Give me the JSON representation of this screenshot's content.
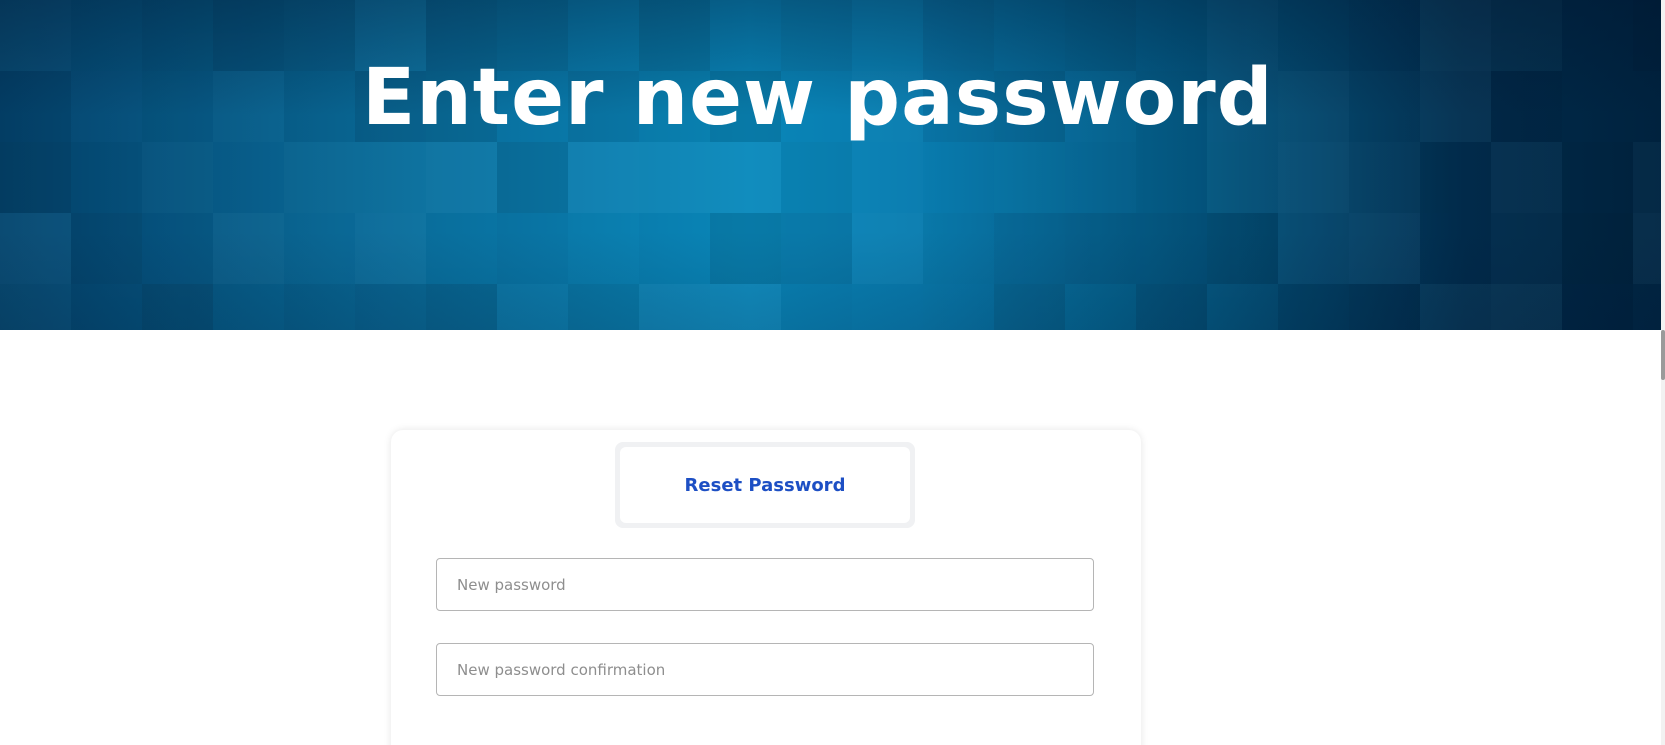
{
  "hero": {
    "title": "Enter new password"
  },
  "form": {
    "tab_label": "Reset Password",
    "new_password": {
      "value": "",
      "placeholder": "New password"
    },
    "new_password_confirmation": {
      "value": "",
      "placeholder": "New password confirmation"
    }
  },
  "colors": {
    "hero_dark": "#01233f",
    "hero_mid": "#04567f",
    "hero_light": "#0a89bb",
    "tab_text": "#1d4fc4",
    "input_border": "#b5b5b5"
  }
}
